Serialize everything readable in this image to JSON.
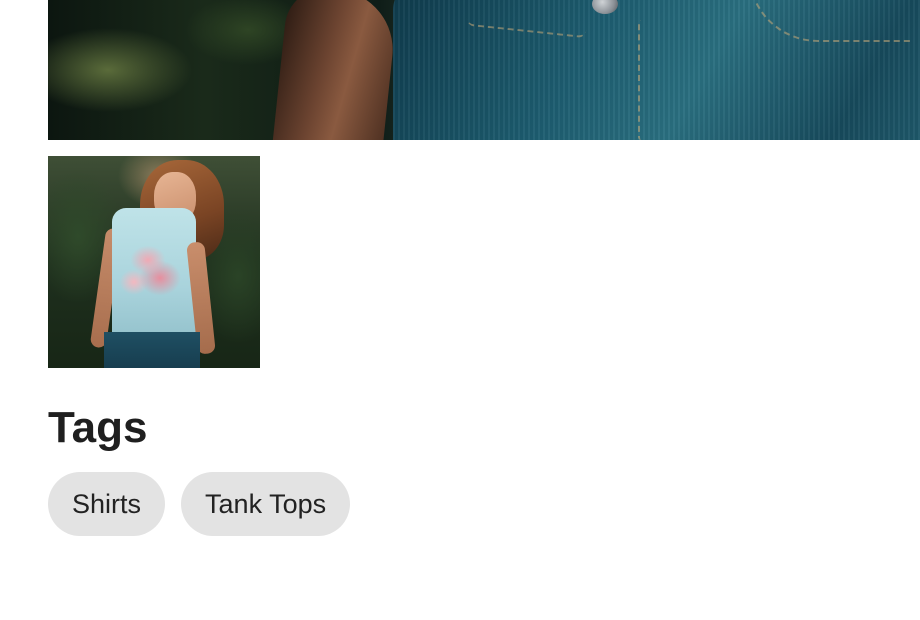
{
  "main_image": {
    "alt": ""
  },
  "thumbnail": {
    "alt": ""
  },
  "tags": {
    "title": "Tags",
    "items": [
      {
        "label": "Shirts"
      },
      {
        "label": "Tank Tops"
      }
    ]
  },
  "colors": {
    "tag_background": "#e3e3e3",
    "text": "#1f1f1f",
    "background": "#ffffff"
  }
}
